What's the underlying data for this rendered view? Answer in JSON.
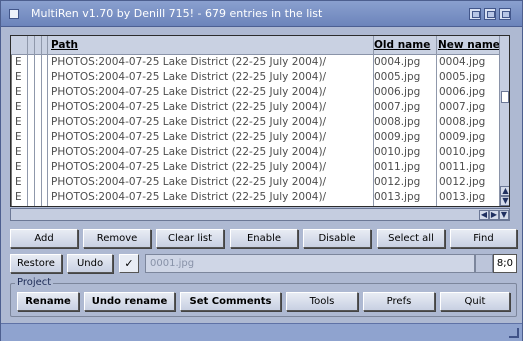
{
  "window": {
    "title": "MultiRen v1.70 by Denill 715! - 679 entries in the list"
  },
  "list": {
    "headers": {
      "path": "Path",
      "old_name": "Old name",
      "new_name": "New name"
    },
    "rows": [
      {
        "flag": "E",
        "path": "PHOTOS:2004-07-25 Lake District (22-25 July 2004)/",
        "old": "0004.jpg",
        "new": "0004.jpg"
      },
      {
        "flag": "E",
        "path": "PHOTOS:2004-07-25 Lake District (22-25 July 2004)/",
        "old": "0005.jpg",
        "new": "0005.jpg"
      },
      {
        "flag": "E",
        "path": "PHOTOS:2004-07-25 Lake District (22-25 July 2004)/",
        "old": "0006.jpg",
        "new": "0006.jpg"
      },
      {
        "flag": "E",
        "path": "PHOTOS:2004-07-25 Lake District (22-25 July 2004)/",
        "old": "0007.jpg",
        "new": "0007.jpg"
      },
      {
        "flag": "E",
        "path": "PHOTOS:2004-07-25 Lake District (22-25 July 2004)/",
        "old": "0008.jpg",
        "new": "0008.jpg"
      },
      {
        "flag": "E",
        "path": "PHOTOS:2004-07-25 Lake District (22-25 July 2004)/",
        "old": "0009.jpg",
        "new": "0009.jpg"
      },
      {
        "flag": "E",
        "path": "PHOTOS:2004-07-25 Lake District (22-25 July 2004)/",
        "old": "0010.jpg",
        "new": "0010.jpg"
      },
      {
        "flag": "E",
        "path": "PHOTOS:2004-07-25 Lake District (22-25 July 2004)/",
        "old": "0011.jpg",
        "new": "0011.jpg"
      },
      {
        "flag": "E",
        "path": "PHOTOS:2004-07-25 Lake District (22-25 July 2004)/",
        "old": "0012.jpg",
        "new": "0012.jpg"
      },
      {
        "flag": "E",
        "path": "PHOTOS:2004-07-25 Lake District (22-25 July 2004)/",
        "old": "0013.jpg",
        "new": "0013.jpg"
      }
    ]
  },
  "actions": {
    "add": "Add",
    "remove": "Remove",
    "clear_list": "Clear list",
    "enable": "Enable",
    "disable": "Disable",
    "select_all": "Select all",
    "find": "Find"
  },
  "edit_row": {
    "restore": "Restore",
    "undo": "Undo",
    "check_mark": "✓",
    "name_value": "0001.jpg",
    "counter": "8;0"
  },
  "project": {
    "label": "Project",
    "rename": "Rename",
    "undo_rename": "Undo rename",
    "set_comments": "Set Comments",
    "tools": "Tools",
    "prefs": "Prefs",
    "quit": "Quit"
  },
  "colors": {
    "titlebar": "#7990c4",
    "window_bg": "#aeb9d2",
    "list_bg": "#ffffff"
  }
}
